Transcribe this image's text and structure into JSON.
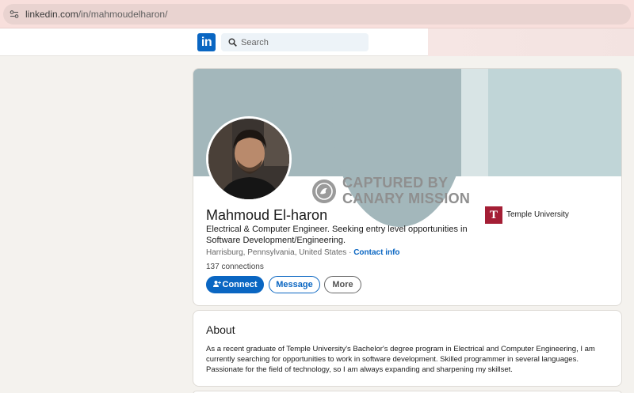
{
  "browser": {
    "url_host": "linkedin.com",
    "url_path": "/in/mahmoudelharon/"
  },
  "nav": {
    "logo_text": "in",
    "search_placeholder": "Search"
  },
  "profile": {
    "name": "Mahmoud El-haron",
    "headline": "Electrical & Computer Engineer. Seeking entry level opportunities in Software Development/Engineering.",
    "location": "Harrisburg, Pennsylvania, United States",
    "separator": " · ",
    "contact_info_label": "Contact info",
    "connections": "137 connections",
    "education": {
      "logo_letter": "T",
      "school": "Temple University"
    },
    "actions": {
      "connect_label": "Connect",
      "message_label": "Message",
      "more_label": "More"
    }
  },
  "watermark": {
    "line1": "CAPTURED BY",
    "line2": "CANARY MISSION"
  },
  "about": {
    "title": "About",
    "text": "As a recent graduate of Temple University's Bachelor's degree program in Electrical and Computer Engineering, I am currently searching for opportunities to work in software development. Skilled programmer in several languages. Passionate for the field of technology, so I am always expanding and sharpening my skillset."
  },
  "colors": {
    "linkedin_blue": "#0a66c2",
    "temple_red": "#a41e35",
    "banner_teal": "#a3b7bb"
  }
}
